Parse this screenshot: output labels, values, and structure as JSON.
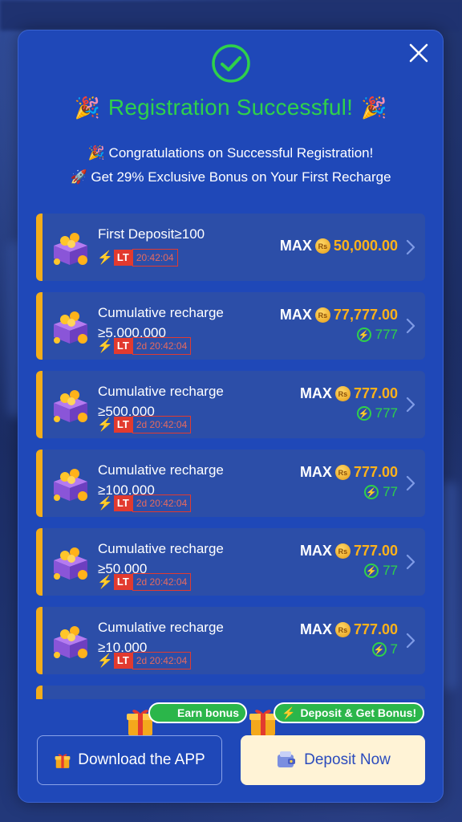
{
  "modal": {
    "title": "Registration Successful!",
    "subtitle_1": "Congratulations on Successful Registration!",
    "subtitle_2": "Get 29% Exclusive Bonus on Your First Recharge"
  },
  "offers": [
    {
      "name": "First Deposit≥100",
      "lt_label": "LT",
      "timer": "20:42:04",
      "max_label": "MAX",
      "currency_icon": "Rs",
      "amount": "50,000.00",
      "bonus": ""
    },
    {
      "name": "Cumulative recharge ≥5.000.000",
      "lt_label": "LT",
      "timer": "2d 20:42:04",
      "max_label": "MAX",
      "currency_icon": "Rs",
      "amount": "77,777.00",
      "bonus": "777"
    },
    {
      "name": "Cumulative recharge ≥500.000",
      "lt_label": "LT",
      "timer": "2d 20:42:04",
      "max_label": "MAX",
      "currency_icon": "Rs",
      "amount": "777.00",
      "bonus": "777"
    },
    {
      "name": "Cumulative recharge ≥100.000",
      "lt_label": "LT",
      "timer": "2d 20:42:04",
      "max_label": "MAX",
      "currency_icon": "Rs",
      "amount": "777.00",
      "bonus": "77"
    },
    {
      "name": "Cumulative recharge ≥50.000",
      "lt_label": "LT",
      "timer": "2d 20:42:04",
      "max_label": "MAX",
      "currency_icon": "Rs",
      "amount": "777.00",
      "bonus": "77"
    },
    {
      "name": "Cumulative recharge ≥10.000",
      "lt_label": "LT",
      "timer": "2d 20:42:04",
      "max_label": "MAX",
      "currency_icon": "Rs",
      "amount": "777.00",
      "bonus": "7"
    }
  ],
  "footer": {
    "earn_badge": "Earn bonus",
    "deposit_badge": "Deposit & Get Bonus!",
    "download_label": "Download the APP",
    "deposit_label": "Deposit Now"
  },
  "colors": {
    "modal_bg": "#1f48b8",
    "card_bg": "#2c4ea8",
    "accent": "#f3ad1a",
    "success_green": "#2fd14a",
    "amount_gold": "#ffb21a",
    "timer_red": "#e23a2f"
  }
}
